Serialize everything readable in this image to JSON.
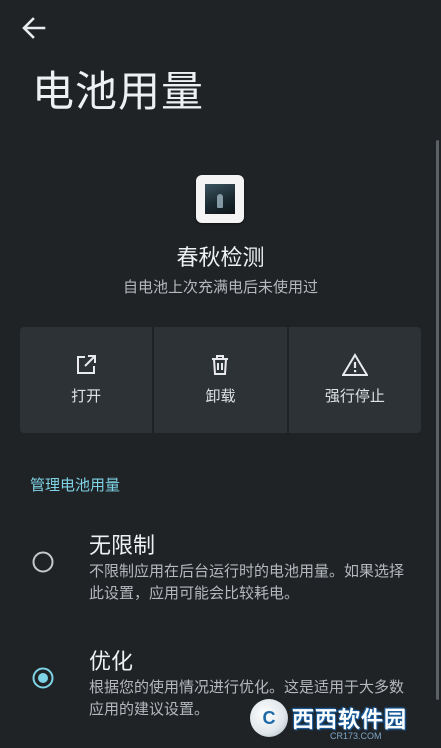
{
  "header": {
    "title": "电池用量"
  },
  "app": {
    "name": "春秋检测",
    "subtitle": "自电池上次充满电后未使用过"
  },
  "actions": [
    {
      "label": "打开",
      "icon": "open-external-icon"
    },
    {
      "label": "卸载",
      "icon": "trash-icon"
    },
    {
      "label": "强行停止",
      "icon": "warning-icon"
    }
  ],
  "section": {
    "title": "管理电池用量"
  },
  "options": [
    {
      "title": "无限制",
      "description": "不限制应用在后台运行时的电池用量。如果选择此设置，应用可能会比较耗电。",
      "selected": false
    },
    {
      "title": "优化",
      "description": "根据您的使用情况进行优化。这是适用于大多数应用的建议设置。",
      "selected": true
    }
  ],
  "watermark": {
    "badge": "C",
    "text": "西西软件园",
    "url": "CR173.COM"
  },
  "colors": {
    "background": "#1f2326",
    "accent": "#7fd3e6",
    "tile": "#2d3236"
  }
}
